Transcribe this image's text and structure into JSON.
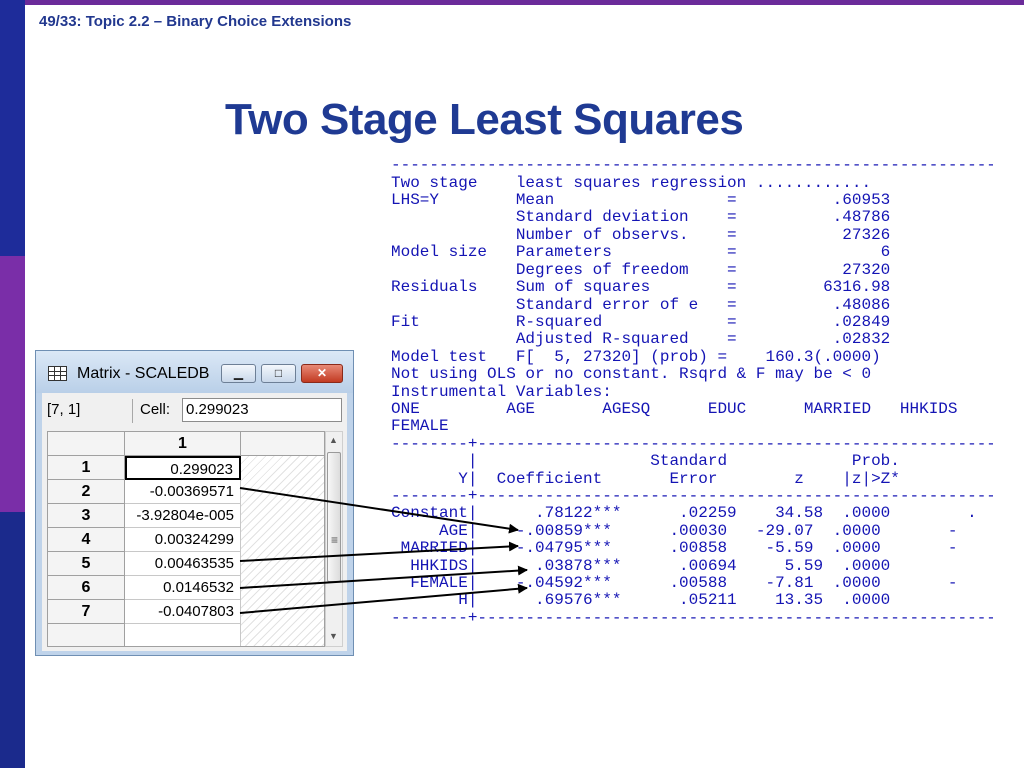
{
  "header": "49/33: Topic 2.2 – Binary Choice Extensions",
  "title": "Two Stage Least Squares",
  "regression_output": [
    "--------------------------------------------------------------------------",
    "Two stage    least squares regression ............",
    "LHS=Y        Mean                  =          .60953",
    "             Standard deviation    =          .48786",
    "             Number of observs.    =           27326",
    "Model size   Parameters            =               6",
    "             Degrees of freedom    =           27320",
    "Residuals    Sum of squares        =         6316.98",
    "             Standard error of e   =          .48086",
    "Fit          R-squared             =          .02849",
    "             Adjusted R-squared    =          .02832",
    "Model test   F[  5, 27320] (prob) =    160.3(.0000)",
    "Not using OLS or no constant. Rsqrd & F may be < 0",
    "Instrumental Variables:",
    "ONE         AGE       AGESQ      EDUC      MARRIED   HHKIDS",
    "FEMALE",
    "--------+-----------------------------------------------------------------",
    "        |                  Standard             Prob.",
    "       Y|  Coefficient       Error        z    |z|>Z*",
    "--------+-----------------------------------------------------------------",
    "Constant|      .78122***      .02259    34.58  .0000        .",
    "     AGE|    -.00859***      .00030   -29.07  .0000       -",
    " MARRIED|    -.04795***      .00858    -5.59  .0000       -",
    "  HHKIDS|      .03878***      .00694     5.59  .0000",
    "  FEMALE|    -.04592***      .00588    -7.81  .0000       -",
    "       H|      .69576***      .05211    13.35  .0000",
    "--------+-----------------------------------------------------------------"
  ],
  "matrix_window": {
    "title": "Matrix - SCALEDB",
    "cell_ref": "[7, 1]",
    "cell_label": "Cell:",
    "cell_value": "0.299023",
    "column_header": "1",
    "row_labels": [
      "1",
      "2",
      "3",
      "4",
      "5",
      "6",
      "7"
    ],
    "values": [
      "0.299023",
      "-0.00369571",
      "-3.92804e-005",
      "0.00324299",
      "0.00463535",
      "0.0146532",
      "-0.0407803"
    ],
    "minimize_icon": "minimize-icon",
    "maximize_icon": "maximize-icon",
    "close_icon": "close-icon"
  },
  "colors": {
    "output_text": "#1414b4",
    "title": "#1f3a93",
    "accent_purple": "#6b2b9a"
  }
}
